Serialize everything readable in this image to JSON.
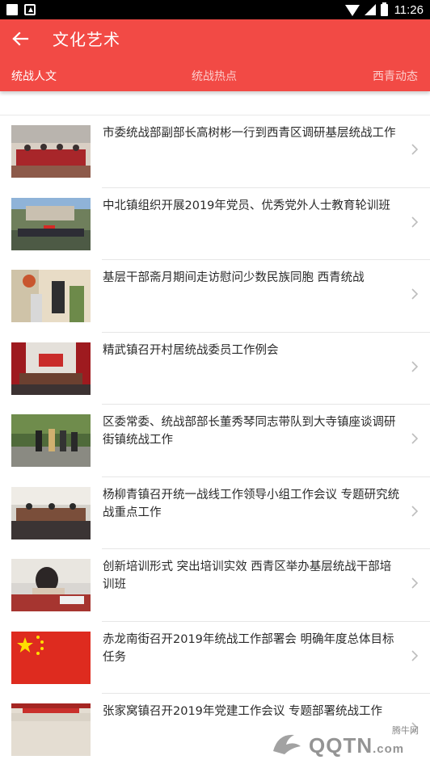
{
  "status_bar": {
    "time": "11:26"
  },
  "header": {
    "back_icon": "back-arrow-icon",
    "title": "文化艺术",
    "background": "#f24a45",
    "tabs": [
      {
        "label": "统战人文",
        "active": true
      },
      {
        "label": "统战热点",
        "active": false
      },
      {
        "label": "西青动态",
        "active": false
      }
    ]
  },
  "news": [
    {
      "title": "市委统战部副部长高树彬一行到西青区调研基层统战工作"
    },
    {
      "title": "中北镇组织开展2019年党员、优秀党外人士教育轮训班"
    },
    {
      "title": "基层干部斋月期间走访慰问少数民族同胞 西青统战"
    },
    {
      "title": "精武镇召开村居统战委员工作例会"
    },
    {
      "title": "区委常委、统战部部长董秀琴同志带队到大寺镇座谈调研街镇统战工作"
    },
    {
      "title": "杨柳青镇召开统一战线工作领导小组工作会议 专题研究统战重点工作"
    },
    {
      "title": "创新培训形式 突出培训实效 西青区举办基层统战干部培训班"
    },
    {
      "title": "赤龙南街召开2019年统战工作部署会 明确年度总体目标任务"
    },
    {
      "title": "张家窝镇召开2019年党建工作会议 专题部署统战工作"
    }
  ],
  "watermark": {
    "small": "腾牛网",
    "text": "QQTN",
    "suffix": ".com"
  }
}
